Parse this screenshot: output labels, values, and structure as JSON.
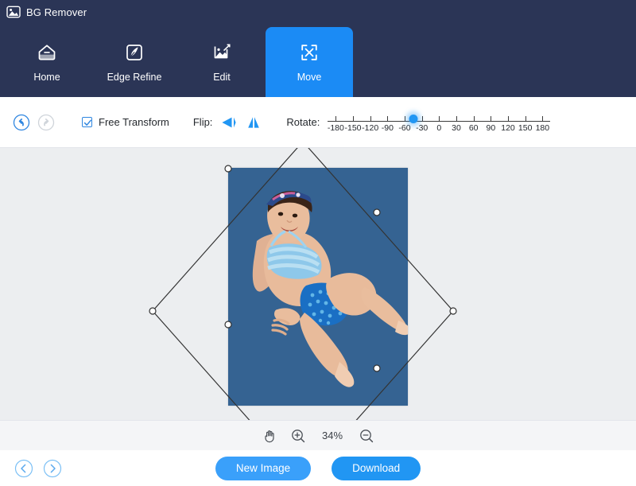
{
  "titlebar": {
    "title": "BG Remover",
    "logo_icon": "image-badge-icon"
  },
  "nav": {
    "tabs": [
      {
        "label": "Home",
        "icon": "home-icon",
        "active": false
      },
      {
        "label": "Edge Refine",
        "icon": "pen-square-icon",
        "active": false
      },
      {
        "label": "Edit",
        "icon": "image-edit-icon",
        "active": false
      },
      {
        "label": "Move",
        "icon": "move-arrows-icon",
        "active": true
      }
    ],
    "active_tab": "Move",
    "active_color": "#1b8bf5",
    "bar_color": "#2b3556"
  },
  "toolbar": {
    "undo_icon": "undo-arrow-icon",
    "redo_icon": "redo-arrow-icon",
    "undo_enabled": true,
    "redo_enabled": false,
    "free_transform_label": "Free Transform",
    "free_transform_checked": true,
    "flip_label": "Flip:",
    "flip_horizontal_icon": "flip-horizontal-icon",
    "flip_vertical_icon": "flip-vertical-icon",
    "rotate_label": "Rotate:",
    "rotate_value": -45,
    "rotate_min": -180,
    "rotate_max": 180,
    "rotate_ticks": [
      "-180",
      "-150",
      "-120",
      "-90",
      "-60",
      "-30",
      "0",
      "30",
      "60",
      "90",
      "120",
      "150",
      "180"
    ],
    "accent_color": "#2196f3"
  },
  "canvas": {
    "background": "#eceef0",
    "image_background": "#356392",
    "selection": {
      "rotated": true,
      "angle_degrees": -45,
      "handle_count": 6,
      "stroke_color": "#333333"
    }
  },
  "zoombar": {
    "pan_icon": "hand-pan-icon",
    "zoom_in_icon": "zoom-in-icon",
    "zoom_level": "34%",
    "zoom_out_icon": "zoom-out-icon"
  },
  "bottombar": {
    "prev_icon": "chevron-left-circle-icon",
    "next_icon": "chevron-right-circle-icon",
    "new_image_label": "New Image",
    "download_label": "Download",
    "button_color": "#2196f3"
  }
}
